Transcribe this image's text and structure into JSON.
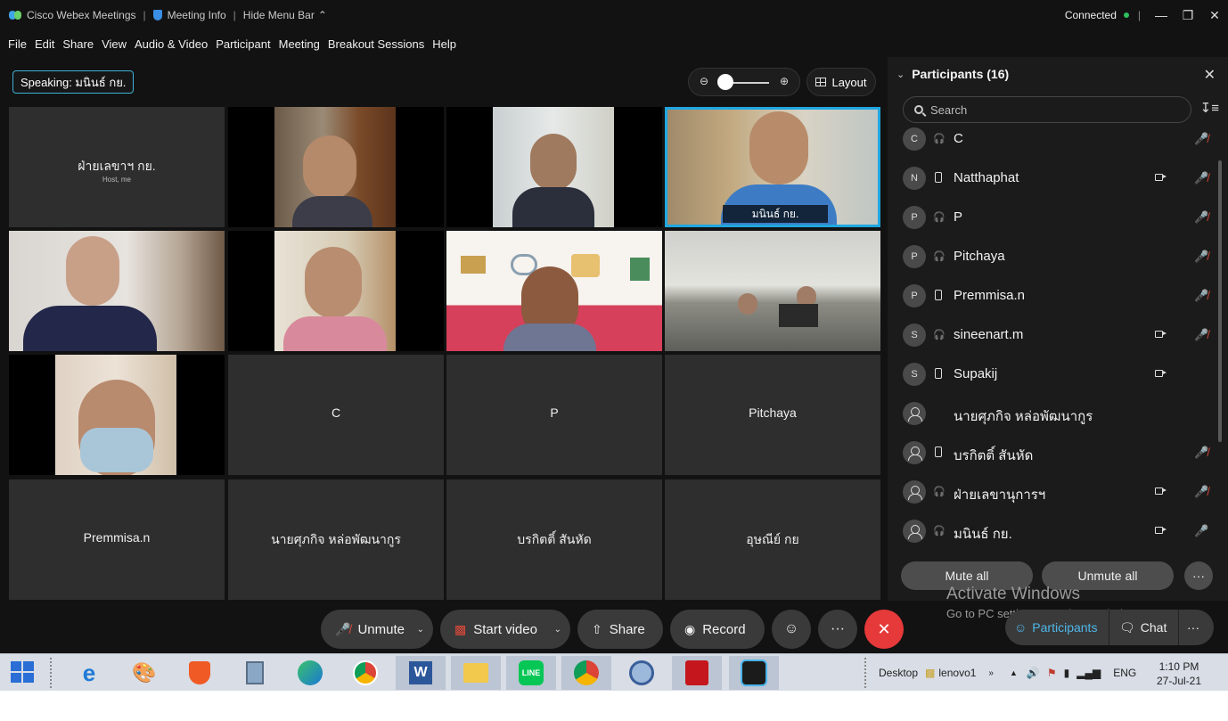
{
  "titlebar": {
    "app_name": "Cisco Webex Meetings",
    "meeting_info": "Meeting Info",
    "hide_menu": "Hide Menu Bar",
    "status": "Connected"
  },
  "menu": [
    "File",
    "Edit",
    "Share",
    "View",
    "Audio & Video",
    "Participant",
    "Meeting",
    "Breakout Sessions",
    "Help"
  ],
  "speaking": "Speaking: มนินธ์ กย.",
  "layout_label": "Layout",
  "tiles": {
    "host_name": "ฝ่ายเลขาฯ กย.",
    "host_sub": "Host, me",
    "active_label": "มนินธ์ กย.",
    "t_c": "C",
    "t_p": "P",
    "t_pitchaya": "Pitchaya",
    "t_premmisa": "Premmisa.n",
    "t_nai": "นายศุภกิจ หล่อพัฒนากูร",
    "t_borakit": "บรกิตติ์ สันหัด",
    "t_uthani": "อุษณีย์ กย"
  },
  "panel": {
    "title": "Participants (16)",
    "search_placeholder": "Search",
    "participants": [
      {
        "initial": "C",
        "name": "C",
        "device": "headset",
        "video": false,
        "mic": "muted"
      },
      {
        "initial": "N",
        "name": "Natthaphat",
        "device": "phone",
        "video": true,
        "mic": "muted"
      },
      {
        "initial": "P",
        "name": "P",
        "device": "headset",
        "video": false,
        "mic": "muted"
      },
      {
        "initial": "P",
        "name": "Pitchaya",
        "device": "headset",
        "video": false,
        "mic": "muted"
      },
      {
        "initial": "P",
        "name": "Premmisa.n",
        "device": "phone",
        "video": false,
        "mic": "muted"
      },
      {
        "initial": "S",
        "name": "sineenart.m",
        "device": "headset",
        "video": true,
        "mic": "muted"
      },
      {
        "initial": "S",
        "name": "Supakij",
        "device": "phone",
        "video": true,
        "mic": "none"
      },
      {
        "initial": "",
        "name": "นายศุภกิจ หล่อพัฒนากูร",
        "device": "none",
        "video": false,
        "mic": "none"
      },
      {
        "initial": "",
        "name": "บรกิตติ์ สันหัด",
        "device": "phone",
        "video": false,
        "mic": "muted"
      },
      {
        "initial": "",
        "name": "ฝ่ายเลขานุการฯ",
        "device": "headset",
        "video": true,
        "mic": "muted"
      },
      {
        "initial": "",
        "name": "มนินธ์ กย.",
        "device": "headset",
        "video": true,
        "mic": "on"
      }
    ],
    "mute_all": "Mute all",
    "unmute_all": "Unmute all"
  },
  "controls": {
    "unmute": "Unmute",
    "start_video": "Start video",
    "share": "Share",
    "record": "Record",
    "participants_tab": "Participants",
    "chat_tab": "Chat"
  },
  "watermark": {
    "line1": "Activate Windows",
    "line2": "Go to PC settings to activate Windows."
  },
  "taskbar": {
    "desktop": "Desktop",
    "user": "lenovo1",
    "lang": "ENG",
    "time": "1:10 PM",
    "date": "27-Jul-21"
  },
  "colors": {
    "accent": "#1fa6e0",
    "muted_mic": "#e04a3a",
    "live_mic": "#2fbf5c",
    "end_call": "#e6393a"
  }
}
